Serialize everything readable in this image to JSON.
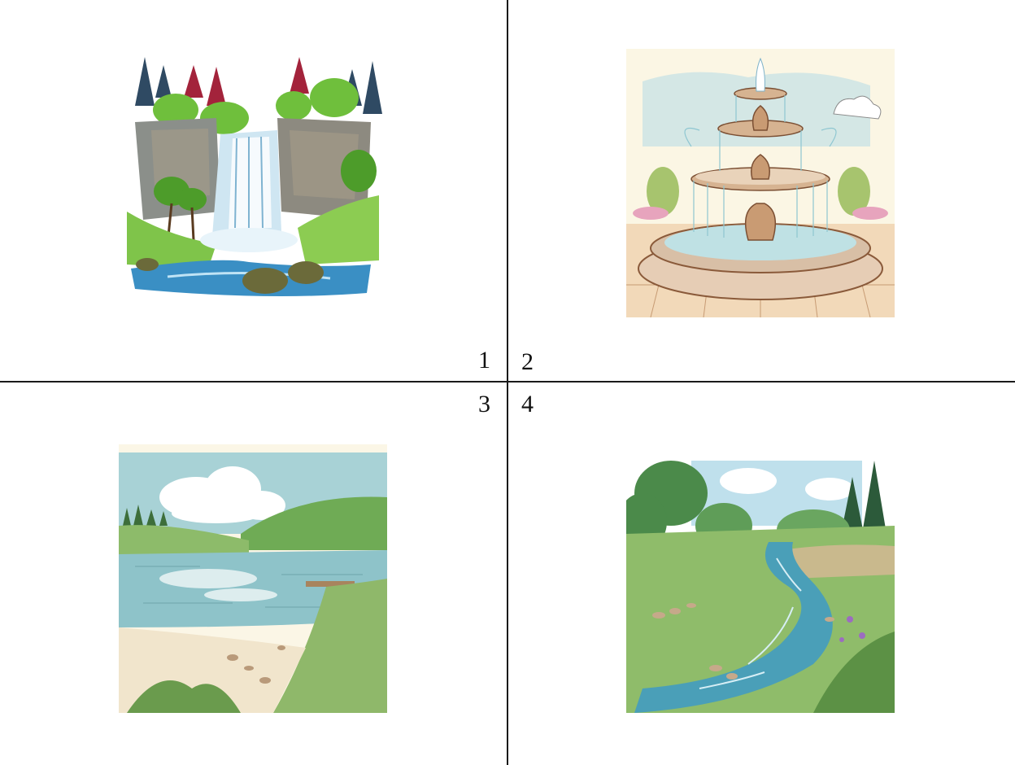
{
  "quadrants": [
    {
      "number": "1",
      "image_icon": "waterfall-illustration-icon"
    },
    {
      "number": "2",
      "image_icon": "fountain-illustration-icon"
    },
    {
      "number": "3",
      "image_icon": "lake-illustration-icon"
    },
    {
      "number": "4",
      "image_icon": "stream-illustration-icon"
    }
  ],
  "colors": {
    "divider": "#1a1a1a",
    "background": "#ffffff"
  }
}
